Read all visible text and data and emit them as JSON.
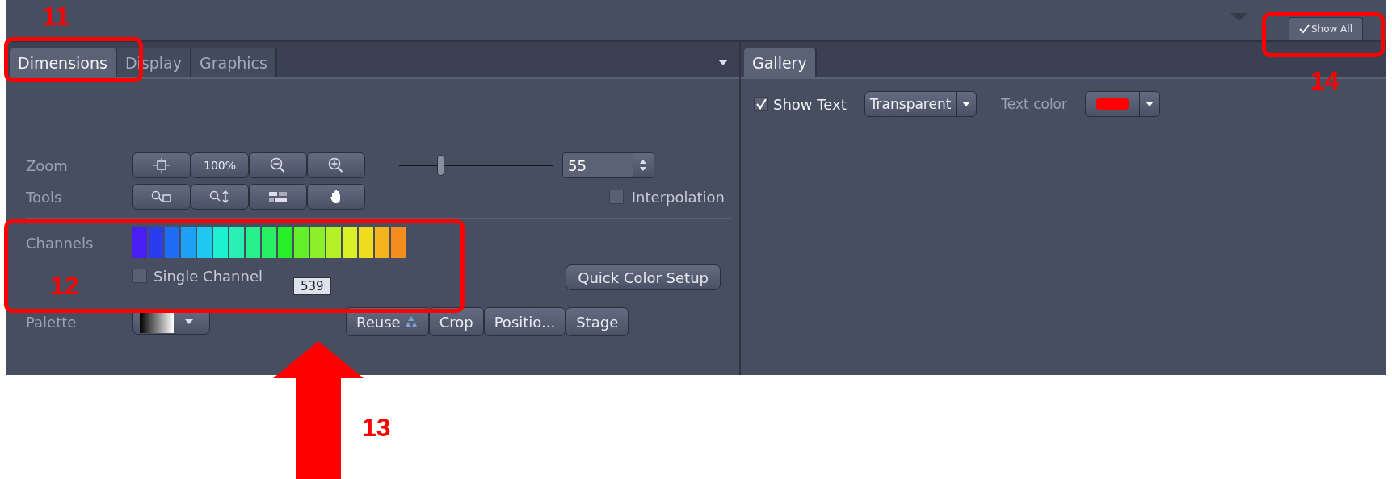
{
  "top_bar": {
    "show_all": {
      "label": "Show All",
      "checked": true
    }
  },
  "left_panel": {
    "tabs": [
      {
        "label": "Dimensions",
        "selected": true
      },
      {
        "label": "Display",
        "selected": false
      },
      {
        "label": "Graphics",
        "selected": false
      }
    ],
    "zoom": {
      "label": "Zoom",
      "buttons": [
        {
          "kind": "fit"
        },
        {
          "kind": "text",
          "label": "100%"
        },
        {
          "kind": "zoom-out"
        },
        {
          "kind": "zoom-in"
        }
      ],
      "slider": {
        "level": 0.27
      },
      "value": "55"
    },
    "tools": {
      "label": "Tools",
      "buttons": [
        {
          "kind": "zoom-rect"
        },
        {
          "kind": "zoom-drag"
        },
        {
          "kind": "tiles"
        },
        {
          "kind": "hand"
        }
      ]
    },
    "interpolation": {
      "label": "Interpolation",
      "checked": false
    },
    "channels": {
      "label": "Channels",
      "swatches": [
        {
          "color": "#4a1ff5"
        },
        {
          "color": "#2a3cf0"
        },
        {
          "color": "#1e6cf5"
        },
        {
          "color": "#1ea0f5"
        },
        {
          "color": "#1ec8f0"
        },
        {
          "color": "#1ef0d2"
        },
        {
          "color": "#28f0b4"
        },
        {
          "color": "#28f08c"
        },
        {
          "color": "#28f064"
        },
        {
          "color": "#28f028"
        },
        {
          "color": "#64f028"
        },
        {
          "color": "#8cf028"
        },
        {
          "color": "#b4f028"
        },
        {
          "color": "#dcf028"
        },
        {
          "color": "#f0dc1e"
        },
        {
          "color": "#f5b41e"
        },
        {
          "color": "#f58c1e"
        }
      ],
      "single_channel": {
        "label": "Single Channel",
        "checked": false
      },
      "tooltip": "539",
      "quick_color_setup": "Quick Color Setup"
    },
    "palette": {
      "label": "Palette",
      "buttons": [
        "Reuse",
        "Crop",
        "Positio...",
        "Stage"
      ]
    }
  },
  "right_panel": {
    "tabs": [
      {
        "label": "Gallery",
        "selected": true
      }
    ],
    "show_text": {
      "label": "Show Text",
      "checked": true
    },
    "background": {
      "value": "Transparent"
    },
    "text_color": {
      "label": "Text color",
      "color": "#ff0000"
    }
  },
  "annotations": [
    {
      "label": "11"
    },
    {
      "label": "12"
    },
    {
      "label": "13"
    },
    {
      "label": "14"
    }
  ]
}
